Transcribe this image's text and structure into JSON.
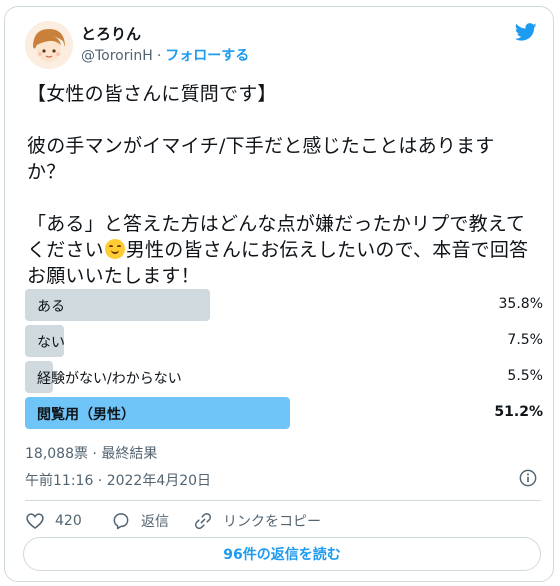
{
  "author": {
    "name": "とろりん",
    "handle": "@TororinH",
    "separator": "·",
    "follow_label": "フォローする"
  },
  "tweet": {
    "text_before_emoji": "【女性の皆さんに質問です】\n\n彼の手マンがイマイチ/下手だと感じたことはありますか？\n\n「ある」と答えた方はどんな点が嫌だったかリプで教えてください",
    "emoji": "smiling-face-icon",
    "text_after_emoji": "男性の皆さんにお伝えしたいので、本音で回答お願いいたします！"
  },
  "poll": {
    "options": [
      {
        "label": "ある",
        "percent_text": "35.8%",
        "percent": 35.8,
        "winner": false
      },
      {
        "label": "ない",
        "percent_text": "7.5%",
        "percent": 7.5,
        "winner": false
      },
      {
        "label": "経験がない/わからない",
        "percent_text": "5.5%",
        "percent": 5.5,
        "winner": false
      },
      {
        "label": "閲覧用（男性）",
        "percent_text": "51.2%",
        "percent": 51.2,
        "winner": true
      }
    ],
    "votes_text": "18,088票 · 最終結果"
  },
  "timestamp": "午前11:16 · 2022年4月20日",
  "actions": {
    "like_count": "420",
    "reply_label": "返信",
    "copy_link_label": "リンクをコピー"
  },
  "read_replies_label": "96件の返信を読む",
  "colors": {
    "accent": "#1d9bf0",
    "poll_bar": "#cfd9de",
    "poll_winner": "#70c5f8"
  }
}
